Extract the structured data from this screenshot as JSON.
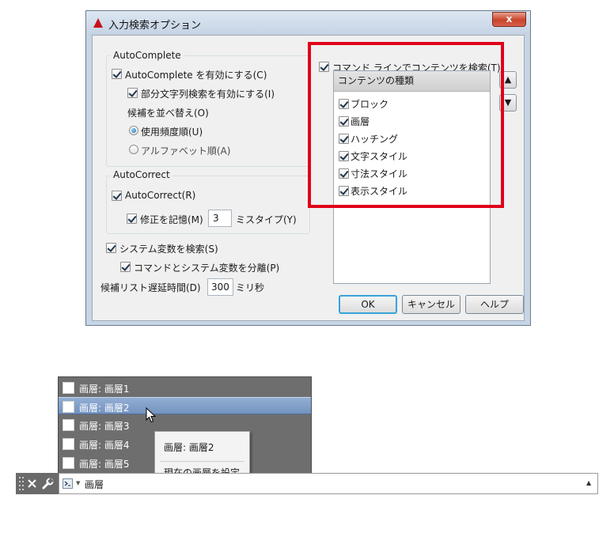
{
  "dialog": {
    "title": "入力検索オプション",
    "close_label": "x",
    "autocomplete": {
      "group_title": "AutoComplete",
      "enable_label": "AutoComplete を有効にする(C)",
      "partial_label": "部分文字列検索を有効にする(I)",
      "sort_label": "候補を並べ替え(O)",
      "sort_options": [
        "使用頻度順(U)",
        "アルファベット順(A)"
      ],
      "sort_selected": "使用頻度順(U)"
    },
    "autocorrect": {
      "group_title": "AutoCorrect",
      "enable_label": "AutoCorrect(R)",
      "remember_label": "修正を記憶(M)",
      "remember_value": "3",
      "suffix_label": "ミスタイプ(Y)"
    },
    "sysvar_label": "システム変数を検索(S)",
    "separate_label": "コマンドとシステム変数を分離(P)",
    "delay_label": "候補リスト遅延時間(D)",
    "delay_value": "300",
    "delay_unit": "ミリ秒",
    "content_search_label": "コマンド ラインでコンテンツを検索(T)",
    "content_types": {
      "header": "コンテンツの種類",
      "items": [
        "ブロック",
        "画層",
        "ハッチング",
        "文字スタイル",
        "寸法スタイル",
        "表示スタイル"
      ]
    },
    "move_up_icon": "triangle-up",
    "move_down_icon": "triangle-down",
    "ok_label": "OK",
    "cancel_label": "キャンセル",
    "help_label": "ヘルプ",
    "highlight_color": "#e0001a"
  },
  "layer_list": {
    "items": [
      "画層:  画層1",
      "画層:  画層2",
      "画層:  画層3",
      "画層:  画層4",
      "画層:  画層5"
    ],
    "selected": "画層:  画層2"
  },
  "tooltip": {
    "title": "画層: 画層2",
    "action": "現在の画層を設定"
  },
  "command_line": {
    "close_icon": "close-icon",
    "settings_icon": "wrench-icon",
    "prompt_icon": "command-prompt-icon",
    "value": "画層",
    "history_icon": "triangle-up"
  }
}
